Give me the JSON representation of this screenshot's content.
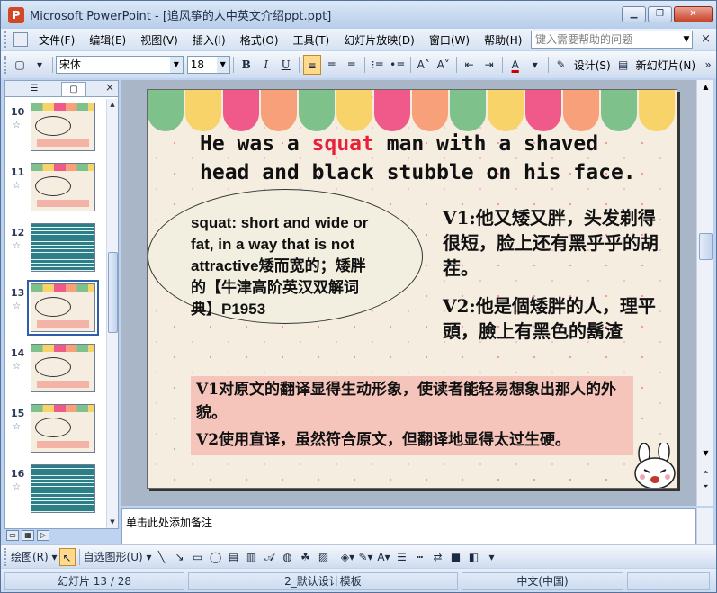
{
  "window": {
    "title": "Microsoft PowerPoint - [追风筝的人中英文介绍ppt.ppt]",
    "app_icon": "powerpoint-icon",
    "controls": [
      "minimize-icon",
      "restore-icon",
      "close-icon"
    ]
  },
  "menubar": {
    "items": [
      "文件(F)",
      "编辑(E)",
      "视图(V)",
      "插入(I)",
      "格式(O)",
      "工具(T)",
      "幻灯片放映(D)",
      "窗口(W)",
      "帮助(H)"
    ],
    "help_placeholder": "键入需要帮助的问题",
    "close_glyph": "×"
  },
  "toolbar": {
    "font_name": "宋体",
    "font_size": "18",
    "bold": "B",
    "italic": "I",
    "underline": "U",
    "design_label": "设计(S)",
    "new_slide_label": "新幻灯片(N)"
  },
  "left_pane": {
    "tabs": [
      "outline-tab",
      "slides-tab"
    ],
    "close_glyph": "×",
    "slides": [
      {
        "number": "10",
        "theme": "pastel-ellipse"
      },
      {
        "number": "11",
        "theme": "pastel-ellipse"
      },
      {
        "number": "12",
        "theme": "teal-text"
      },
      {
        "number": "13",
        "theme": "pastel-ellipse",
        "selected": true
      },
      {
        "number": "14",
        "theme": "pastel-ellipse"
      },
      {
        "number": "15",
        "theme": "pastel-ellipse"
      },
      {
        "number": "16",
        "theme": "teal-text"
      }
    ]
  },
  "slide": {
    "headline_pre": "He was a ",
    "headline_highlight": "squat",
    "headline_post": " man with a shaved head and black stubble on his face.",
    "definition": "squat: short and wide or fat, in a way that is not attractive矮而宽的；矮胖的【牛津高阶英汉双解词典】P1953",
    "v1": "V1:他又矮又胖，头发剃得很短，脸上还有黑乎乎的胡茬。",
    "v2": "V2:他是個矮胖的人，理平頭，臉上有黑色的鬍渣",
    "note1": "V1对原文的翻译显得生动形象，使读者能轻易想象出那人的外貌。",
    "note2": "V2使用直译，虽然符合原文，但翻译地显得太过生硬。",
    "colors": {
      "highlight": "#e8203a",
      "note_bg": "#f5c5bb",
      "background": "#f5ede0"
    },
    "awning_colors": [
      "#7fc18a",
      "#f7d36a",
      "#f05a8a",
      "#f7a07a",
      "#7fc18a",
      "#f7d36a",
      "#f05a8a",
      "#f7a07a",
      "#7fc18a",
      "#f7d36a",
      "#f05a8a",
      "#f7a07a",
      "#7fc18a",
      "#f7d36a"
    ]
  },
  "notes": {
    "placeholder": "单击此处添加备注"
  },
  "drawbar": {
    "draw_label": "绘图(R)",
    "autoshapes_label": "自选图形(U)"
  },
  "statusbar": {
    "slide_info": "幻灯片 13 / 28",
    "template": "2_默认设计模板",
    "language": "中文(中国)"
  }
}
